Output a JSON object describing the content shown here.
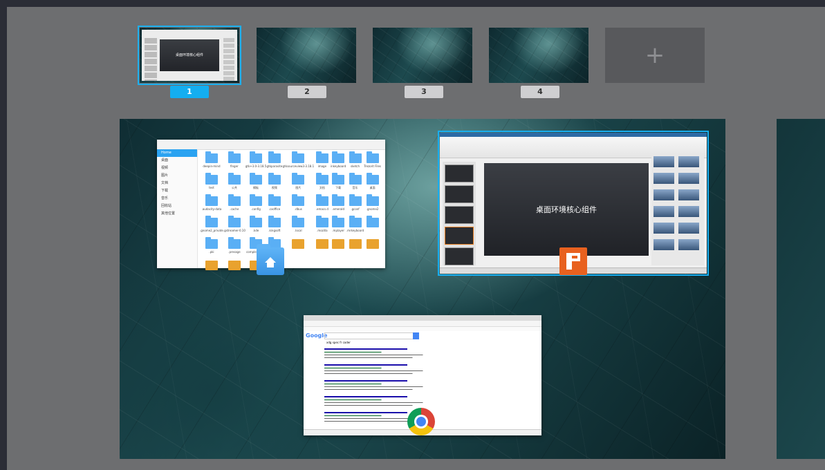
{
  "workspaces": [
    {
      "label": "1",
      "active": true
    },
    {
      "label": "2",
      "active": false
    },
    {
      "label": "3",
      "active": false
    },
    {
      "label": "4",
      "active": false
    }
  ],
  "add_workspace_symbol": "+",
  "file_manager": {
    "sidebar": [
      "Home",
      "桌面",
      "视频",
      "图片",
      "文档",
      "下载",
      "音乐",
      "回收站",
      "其他位置"
    ],
    "items": [
      "deepin-mind",
      "finger",
      "gtk+3.0-3.18.5",
      "gtkparasite",
      "gtksourceview3-3.18.1",
      "image",
      "inkeyboard",
      "sketch",
      "Trezorit Files",
      "test",
      "公共",
      "模板",
      "视频",
      "图片",
      "文档",
      "下载",
      "音乐",
      "桌面",
      ".audacity-data",
      ".cache",
      ".config",
      ".cxoffice",
      ".dbus",
      ".emacs.d",
      ".emerald",
      ".gconf",
      ".gnome2",
      ".gnome2_private",
      ".gstreamer-0.10",
      ".kde",
      ".kingsoft",
      ".local",
      ".mozilla",
      ".mplayer",
      ".mrkeyboard",
      "",
      ".pki",
      ".presage",
      "comple-music",
      ".ssh",
      "",
      "",
      "",
      "",
      "",
      "",
      "",
      ""
    ]
  },
  "presentation": {
    "slide_title": "桌面环境核心组件"
  },
  "active_thumb_slide_text": "桌面环境核心组件",
  "browser": {
    "logo": "Google",
    "query": "xdg spec fr coder"
  },
  "colors": {
    "accent": "#14aef0",
    "wps": "#e8611f"
  }
}
